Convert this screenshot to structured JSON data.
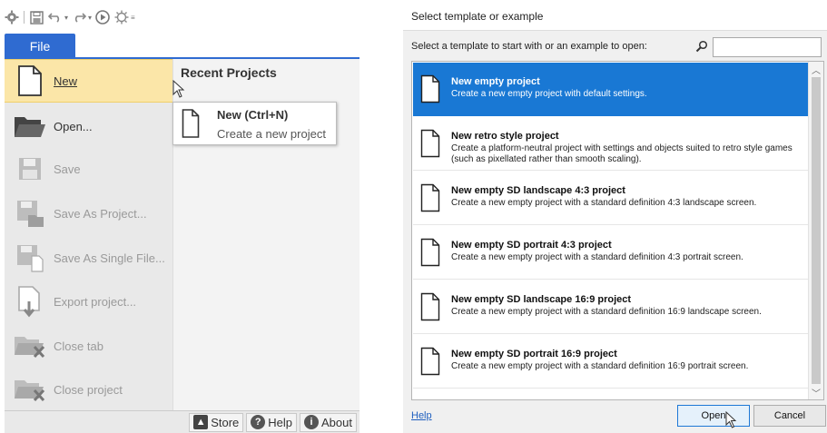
{
  "left": {
    "file_tab_label": "File",
    "recent_title": "Recent Projects",
    "menu": [
      {
        "label": "New",
        "icon": "new-document-icon",
        "state": "hover"
      },
      {
        "label": "Open...",
        "icon": "open-folder-icon",
        "state": "enabled"
      },
      {
        "label": "Save",
        "icon": "save-icon",
        "state": "disabled"
      },
      {
        "label": "Save As Project...",
        "icon": "save-as-project-icon",
        "state": "disabled"
      },
      {
        "label": "Save As Single File...",
        "icon": "save-as-single-file-icon",
        "state": "disabled"
      },
      {
        "label": "Export project...",
        "icon": "export-project-icon",
        "state": "disabled"
      },
      {
        "label": "Close tab",
        "icon": "close-tab-icon",
        "state": "disabled"
      },
      {
        "label": "Close project",
        "icon": "close-project-icon",
        "state": "disabled"
      }
    ],
    "tooltip": {
      "title": "New (Ctrl+N)",
      "desc": "Create a new project"
    },
    "bottom": {
      "store": "Store",
      "help": "Help",
      "about": "About"
    }
  },
  "dialog": {
    "title": "Select template or example",
    "prompt": "Select a template to start with or an example to open:",
    "search": {
      "value": "",
      "placeholder": ""
    },
    "templates": [
      {
        "name": "New empty project",
        "desc": "Create a new empty project with default settings.",
        "selected": true
      },
      {
        "name": "New retro style project",
        "desc": "Create a platform-neutral project with settings and objects suited to retro style games (such as pixellated rather than smooth scaling).",
        "selected": false
      },
      {
        "name": "New empty SD landscape 4:3 project",
        "desc": "Create a new empty project with a standard definition 4:3 landscape screen.",
        "selected": false
      },
      {
        "name": "New empty SD portrait 4:3 project",
        "desc": "Create a new empty project with a standard definition 4:3 portrait screen.",
        "selected": false
      },
      {
        "name": "New empty SD landscape 16:9 project",
        "desc": "Create a new empty project with a standard definition 16:9 landscape screen.",
        "selected": false
      },
      {
        "name": "New empty SD portrait 16:9 project",
        "desc": "Create a new empty project with a standard definition 16:9 portrait screen.",
        "selected": false
      }
    ],
    "help_link": "Help",
    "open_label": "Open",
    "cancel_label": "Cancel"
  },
  "colors": {
    "accent": "#2f6bd1",
    "selection": "#1978d4",
    "hover": "#fbe6a8"
  }
}
